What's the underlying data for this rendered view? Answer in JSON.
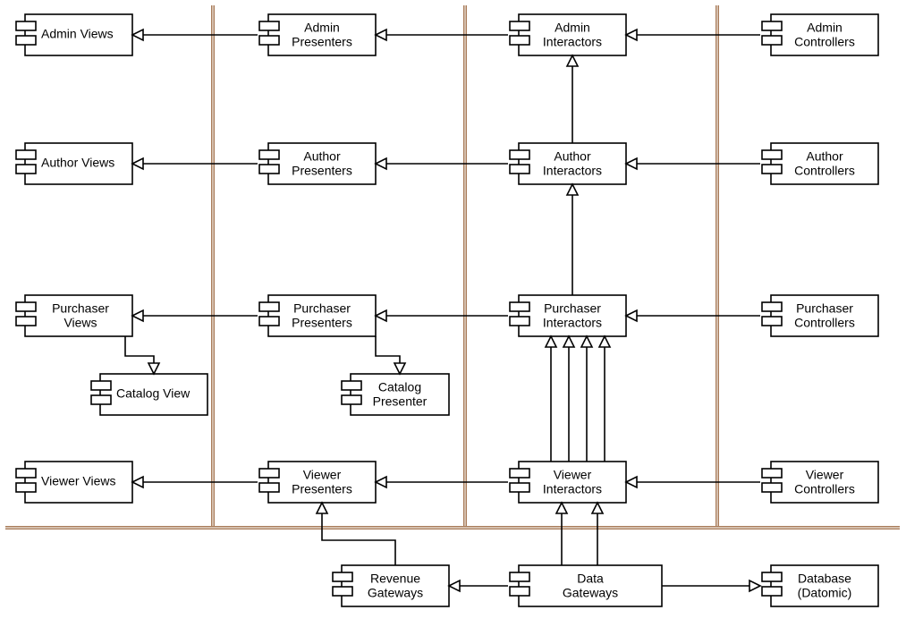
{
  "components": {
    "admin_views": {
      "l1": "Admin Views"
    },
    "admin_presenters": {
      "l1": "Admin",
      "l2": "Presenters"
    },
    "admin_interactors": {
      "l1": "Admin",
      "l2": "Interactors"
    },
    "admin_controllers": {
      "l1": "Admin",
      "l2": "Controllers"
    },
    "author_views": {
      "l1": "Author Views"
    },
    "author_presenters": {
      "l1": "Author",
      "l2": "Presenters"
    },
    "author_interactors": {
      "l1": "Author",
      "l2": "Interactors"
    },
    "author_controllers": {
      "l1": "Author",
      "l2": "Controllers"
    },
    "purchaser_views": {
      "l1": "Purchaser",
      "l2": "Views"
    },
    "purchaser_presenters": {
      "l1": "Purchaser",
      "l2": "Presenters"
    },
    "purchaser_interactors": {
      "l1": "Purchaser",
      "l2": "Interactors"
    },
    "purchaser_controllers": {
      "l1": "Purchaser",
      "l2": "Controllers"
    },
    "catalog_view": {
      "l1": "Catalog View"
    },
    "catalog_presenter": {
      "l1": "Catalog",
      "l2": "Presenter"
    },
    "viewer_views": {
      "l1": "Viewer Views"
    },
    "viewer_presenters": {
      "l1": "Viewer",
      "l2": "Presenters"
    },
    "viewer_interactors": {
      "l1": "Viewer",
      "l2": "Interactors"
    },
    "viewer_controllers": {
      "l1": "Viewer",
      "l2": "Controllers"
    },
    "revenue_gateways": {
      "l1": "Revenue",
      "l2": "Gateways"
    },
    "data_gateways": {
      "l1": "Data",
      "l2": "Gateways"
    },
    "database": {
      "l1": "Database",
      "l2": "(Datomic)"
    }
  }
}
